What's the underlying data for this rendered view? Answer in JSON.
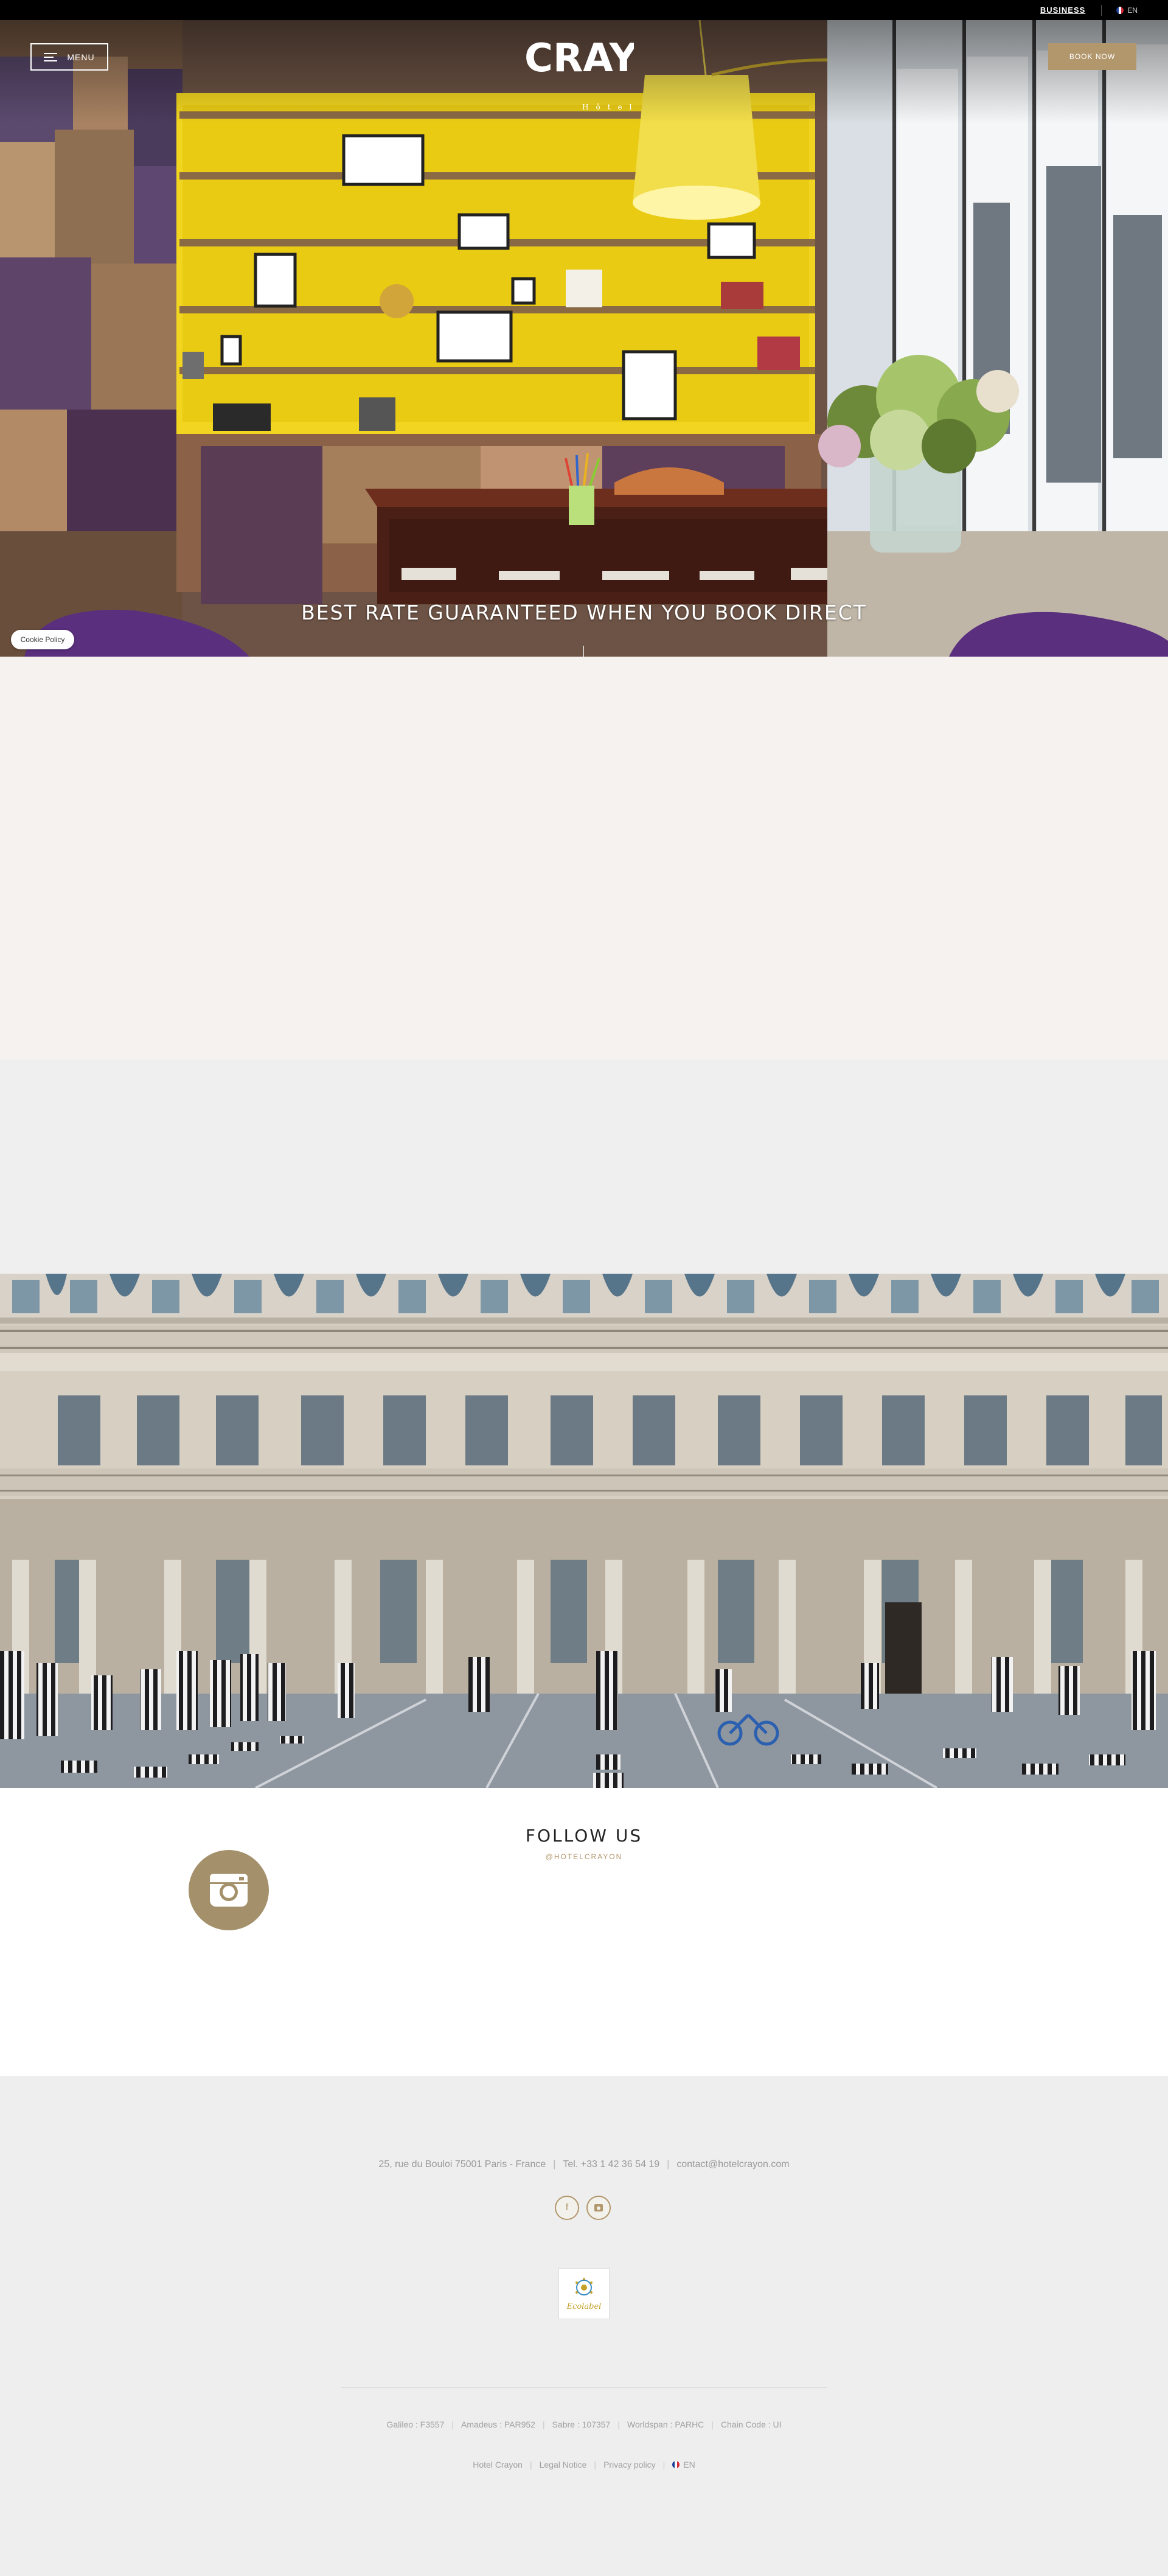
{
  "topbar": {
    "business": "BUSINESS",
    "lang": "EN"
  },
  "header": {
    "menu_label": "MENU",
    "book_label": "BOOK NOW",
    "logo_text": "CRAYON",
    "logo_sub": "Hôtel"
  },
  "hero": {
    "title": "BEST RATE GUARANTEED WHEN YOU BOOK DIRECT"
  },
  "cookie": {
    "label": "Cookie Policy"
  },
  "follow": {
    "title": "FOLLOW US",
    "handle": "@HOTELCRAYON"
  },
  "footer": {
    "address": "25, rue du Bouloi 75001 Paris - France",
    "phone": "Tel. +33 1 42 36 54 19",
    "email": "contact@hotelcrayon.com",
    "ecolabel": "Ecolabel",
    "codes": [
      "Galileo : F3557",
      "Amadeus : PAR952",
      "Sabre : 107357",
      "Worldspan : PARHC",
      "Chain Code : UI"
    ],
    "links": [
      "Hotel Crayon",
      "Legal Notice",
      "Privacy policy"
    ],
    "lang": "EN"
  },
  "colors": {
    "accent": "#b2976c",
    "beige": "#f5f2ef",
    "footer_bg": "#eeeeee"
  }
}
